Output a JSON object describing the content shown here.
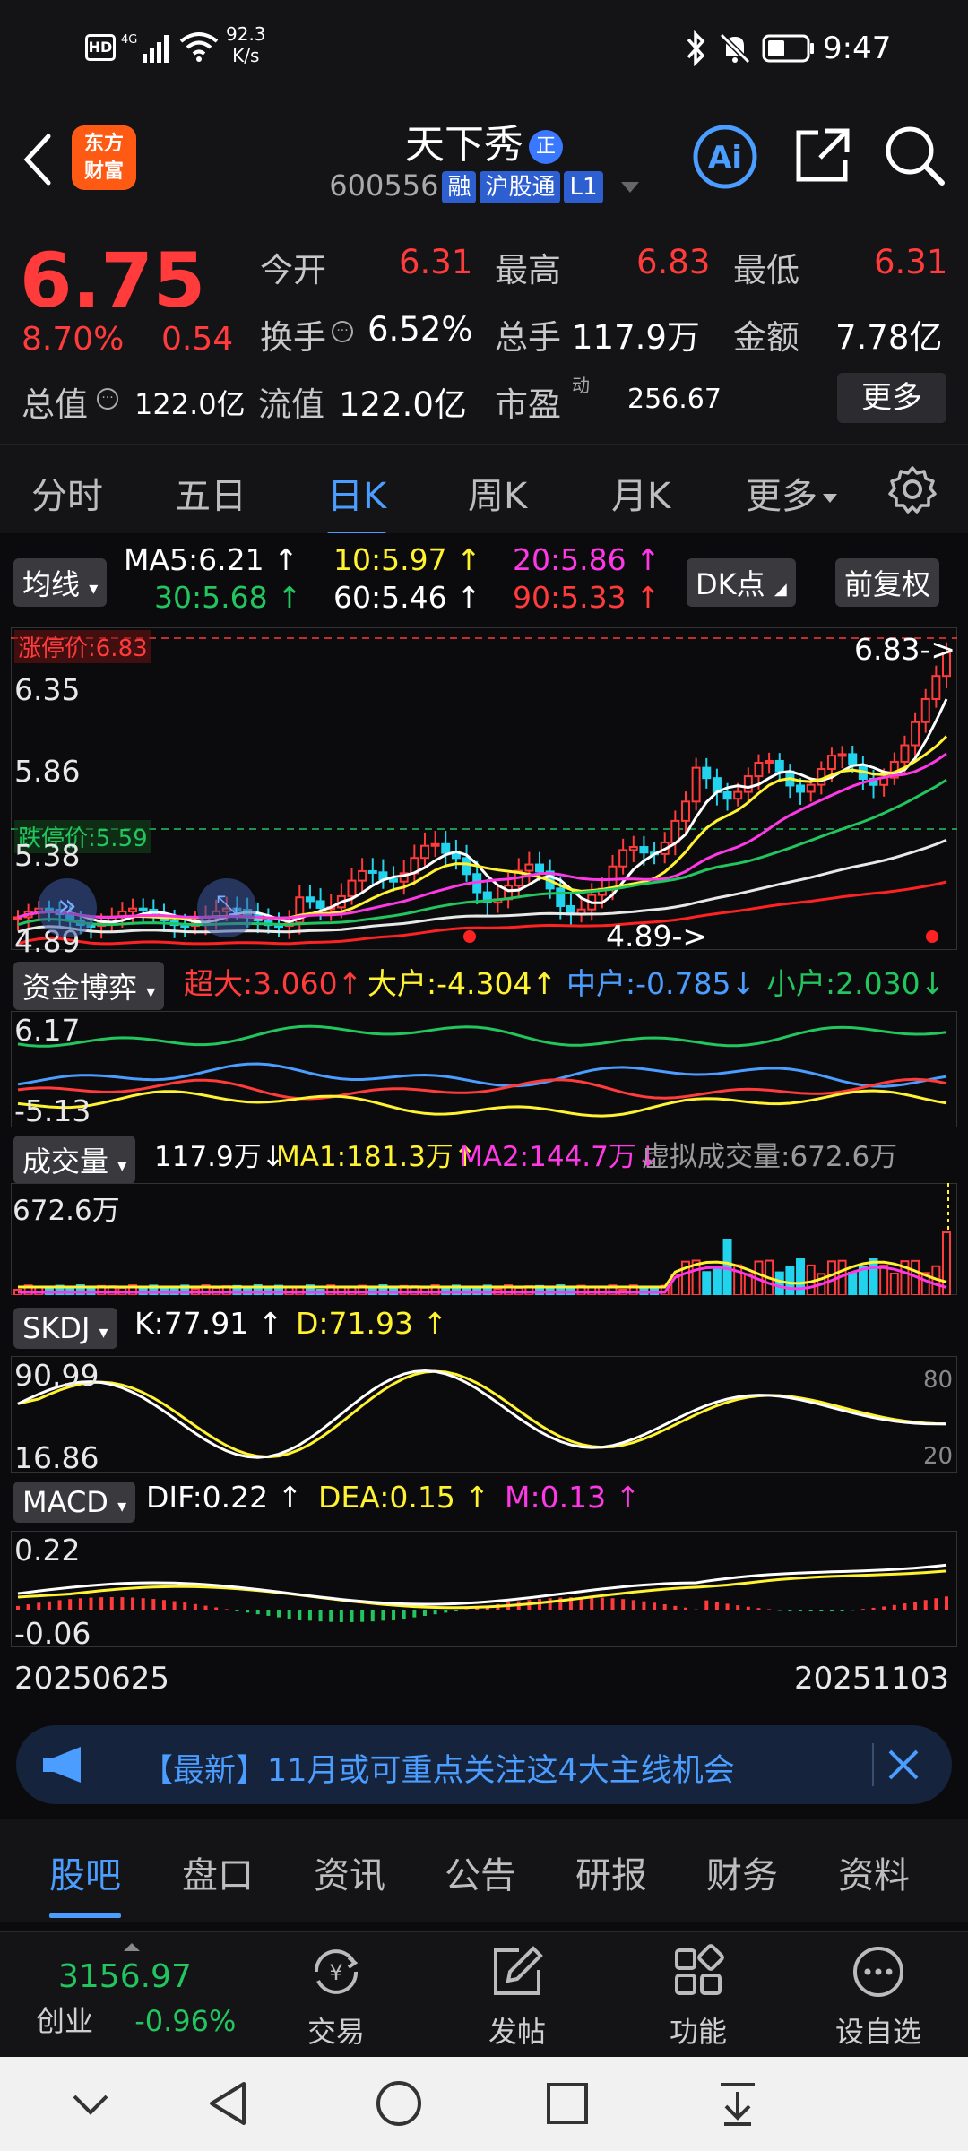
{
  "status": {
    "speed": "92.3",
    "speed_unit": "K/s",
    "time": "9:47"
  },
  "header": {
    "logo_line1": "东方",
    "logo_line2": "财富",
    "stock_name": "天下秀",
    "name_badge": "正",
    "code": "600556",
    "tag_rong": "融",
    "tag_hgt": "沪股通",
    "tag_level": "L1"
  },
  "quote": {
    "price": "6.75",
    "change_pct": "8.70%",
    "change": "0.54",
    "open_label": "今开",
    "open": "6.31",
    "high_label": "最高",
    "high": "6.83",
    "low_label": "最低",
    "low": "6.31",
    "turnover_label": "换手",
    "turnover": "6.52%",
    "volume_label": "总手",
    "volume": "117.9万",
    "amount_label": "金额",
    "amount": "7.78亿",
    "mktcap_label": "总值",
    "mktcap": "122.0亿",
    "float_label": "流值",
    "float": "122.0亿",
    "pe_label": "市盈",
    "pe_sup": "动",
    "pe": "256.67",
    "more": "更多"
  },
  "tabs": [
    "分时",
    "五日",
    "日K",
    "周K",
    "月K",
    "更多"
  ],
  "kline": {
    "ma_button": "均线",
    "ma5": "MA5:6.21",
    "ma10": "10:5.97",
    "ma20": "20:5.86",
    "ma30": "30:5.68",
    "ma60": "60:5.46",
    "ma90": "90:5.33",
    "dk": "DK点",
    "adjust": "前复权",
    "limit_up": "涨停价:6.83",
    "limit_down": "跌停价:5.59",
    "y1": "6.83",
    "y2": "6.35",
    "y3": "5.86",
    "y4": "5.38",
    "y5": "4.89",
    "max_marker": "6.83->",
    "min_marker": "4.89->"
  },
  "capital": {
    "button": "资金博弈",
    "super": "超大:3.060",
    "large": "大户:-4.304",
    "mid": "中户:-0.785",
    "small": "小户:2.030",
    "y_top": "6.17",
    "y_bot": "-5.13"
  },
  "volume": {
    "button": "成交量",
    "vol": "117.9万",
    "ma1": "MA1:181.3万",
    "ma2": "MA2:144.7万",
    "virtual": "虚拟成交量:672.6万",
    "y_top": "672.6万"
  },
  "skdj": {
    "button": "SKDJ",
    "k": "K:77.91",
    "d": "D:71.93",
    "y_top": "90.99",
    "y_bot": "16.86",
    "lvl80": "80",
    "lvl20": "20"
  },
  "macd": {
    "button": "MACD",
    "dif": "DIF:0.22",
    "dea": "DEA:0.15",
    "m": "M:0.13",
    "y_top": "0.22",
    "y_bot": "-0.06"
  },
  "dates": {
    "start": "20250625",
    "end": "20251103"
  },
  "news": {
    "text": "【最新】11月或可重点关注这4大主线机会"
  },
  "bottom_tabs": [
    "股吧",
    "盘口",
    "资讯",
    "公告",
    "研报",
    "财务",
    "资料"
  ],
  "toolbar": {
    "index_value": "3156.97",
    "index_name": "创业",
    "index_change": "-0.96%",
    "trade": "交易",
    "post": "发帖",
    "function": "功能",
    "watch": "设自选"
  },
  "colors": {
    "up": "#ff3b3b",
    "down": "#22c55e",
    "accent": "#4b9dff"
  }
}
